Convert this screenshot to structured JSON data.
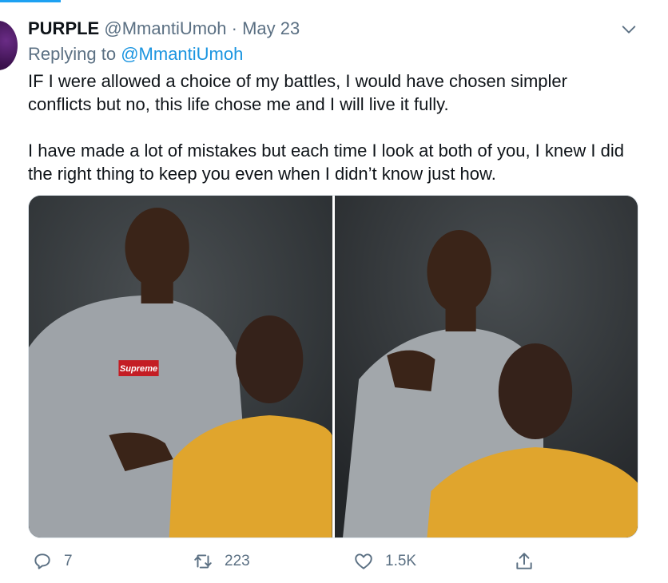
{
  "tweet": {
    "author_name": "PURPLE",
    "author_handle": "@MmantiUmoh",
    "separator": "·",
    "date": "May 23",
    "replying_to_label": "Replying to",
    "replying_to_handle": "@MmantiUmoh",
    "text": "IF I were allowed a choice of my battles, I would have chosen simpler conflicts but no, this life chose me and I will live it fully.\n\nI have made a lot of mistakes but each time I look at both of you, I knew I did the right thing to keep you even when I didn’t know just how.",
    "media": [
      {
        "description_icon": "photo-two-men-grey-sweatshirt-and-yellow-sweatshirt",
        "logo_text": "Supreme"
      },
      {
        "description_icon": "photo-two-men-hand-on-shoulder"
      }
    ]
  },
  "actions": {
    "reply_count": "7",
    "retweet_count": "223",
    "like_count": "1.5K"
  },
  "icons": [
    "chevron-down-icon",
    "reply-icon",
    "retweet-icon",
    "like-icon",
    "share-icon"
  ],
  "colors": {
    "accent": "#1da1f2",
    "link": "#1b95e0",
    "muted": "#5b7083",
    "text": "#0f1419"
  }
}
